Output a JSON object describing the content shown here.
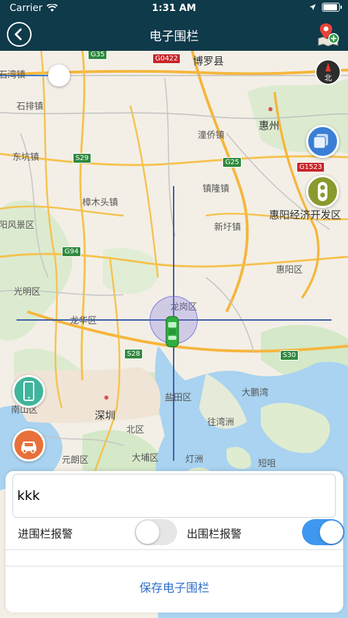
{
  "status_bar": {
    "carrier": "Carrier",
    "time": "1:31 AM"
  },
  "nav": {
    "title": "电子围栏"
  },
  "map": {
    "compass_label": "北",
    "places": [
      {
        "id": "boluo",
        "label": "博罗县",
        "big": true
      },
      {
        "id": "shipai",
        "label": "石排镇"
      },
      {
        "id": "huizhou",
        "label": "惠州",
        "big": true
      },
      {
        "id": "dongkeng",
        "label": "东坑镇"
      },
      {
        "id": "chongqiao",
        "label": "潼侨镇"
      },
      {
        "id": "zhangmutou",
        "label": "樟木头镇"
      },
      {
        "id": "zhenlong",
        "label": "镇隆镇"
      },
      {
        "id": "huiyang_dev",
        "label": "惠阳经济开发区",
        "big": true
      },
      {
        "id": "scenic",
        "label": "阳风景区"
      },
      {
        "id": "xinxu",
        "label": "新圩镇"
      },
      {
        "id": "huiyang",
        "label": "惠阳区"
      },
      {
        "id": "guangming",
        "label": "光明区"
      },
      {
        "id": "longgang",
        "label": "龙岗区"
      },
      {
        "id": "longhua",
        "label": "龙华区"
      },
      {
        "id": "dapengwan",
        "label": "大鹏湾"
      },
      {
        "id": "yantian",
        "label": "盐田区"
      },
      {
        "id": "nanshan",
        "label": "南山区"
      },
      {
        "id": "shenzhen",
        "label": "深圳",
        "big": true
      },
      {
        "id": "wangwanzhou",
        "label": "往湾洲"
      },
      {
        "id": "beiqu",
        "label": "北区"
      },
      {
        "id": "yuanlang",
        "label": "元朗区"
      },
      {
        "id": "dabu",
        "label": "大埔区"
      },
      {
        "id": "dengzhou",
        "label": "灯洲"
      },
      {
        "id": "duanzhu",
        "label": "短咀"
      },
      {
        "id": "shiwan",
        "label": "石湾镇"
      }
    ],
    "shields": [
      {
        "id": "g35",
        "label": "G35",
        "red": false
      },
      {
        "id": "g0422",
        "label": "G0422",
        "red": true
      },
      {
        "id": "s29",
        "label": "S29",
        "red": false
      },
      {
        "id": "g25",
        "label": "G25",
        "red": false
      },
      {
        "id": "g1523",
        "label": "G1523",
        "red": true
      },
      {
        "id": "g94",
        "label": "G94",
        "red": false
      },
      {
        "id": "s28",
        "label": "S28",
        "red": false
      },
      {
        "id": "s30",
        "label": "S30",
        "red": false
      }
    ]
  },
  "fence_form": {
    "name_value": "kkk",
    "name_placeholder": "",
    "enter_alarm_label": "进围栏报警",
    "enter_alarm_on": false,
    "exit_alarm_label": "出围栏报警",
    "exit_alarm_on": true,
    "save_label": "保存电子围栏"
  },
  "colors": {
    "nav_bg": "#0f3a4a",
    "accent": "#3f97f0",
    "save_text": "#2f6fc6",
    "crosshair": "#3a5aa6",
    "fence_fill": "#8278e6",
    "car": "#2fae3f"
  },
  "icons": {
    "back": "chevron-left-icon",
    "add_geo": "map-pin-plus-icon",
    "layers": "layers-icon",
    "traffic": "traffic-light-icon",
    "phone_locate": "phone-icon",
    "car_locate": "car-icon"
  }
}
